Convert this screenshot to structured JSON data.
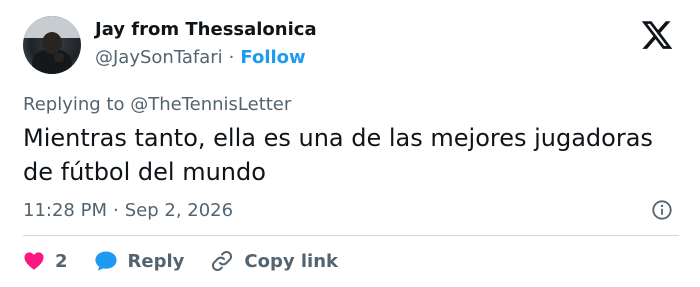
{
  "header": {
    "display_name": "Jay from Thessalonica",
    "handle": "@JaySonTafari",
    "separator": "·",
    "follow_label": "Follow"
  },
  "reply_context": {
    "prefix": "Replying to",
    "mention": "@TheTennisLetter"
  },
  "tweet": {
    "text": "Mientras tanto, ella es una de las mejores jugadoras de fútbol del mundo"
  },
  "meta": {
    "time": "11:28 PM",
    "separator": "·",
    "date": "Sep 2, 2026"
  },
  "actions": {
    "like_count": "2",
    "reply_label": "Reply",
    "copy_link_label": "Copy link"
  },
  "icons": {
    "brand": "x-logo-icon",
    "info": "info-icon",
    "like": "heart-icon",
    "reply": "speech-bubble-icon",
    "copy": "link-icon"
  },
  "colors": {
    "follow": "#1d9bf0",
    "heart": "#f91880",
    "reply_bubble": "#1d9bf0",
    "secondary_text": "#536471",
    "primary_text": "#0f1419"
  }
}
